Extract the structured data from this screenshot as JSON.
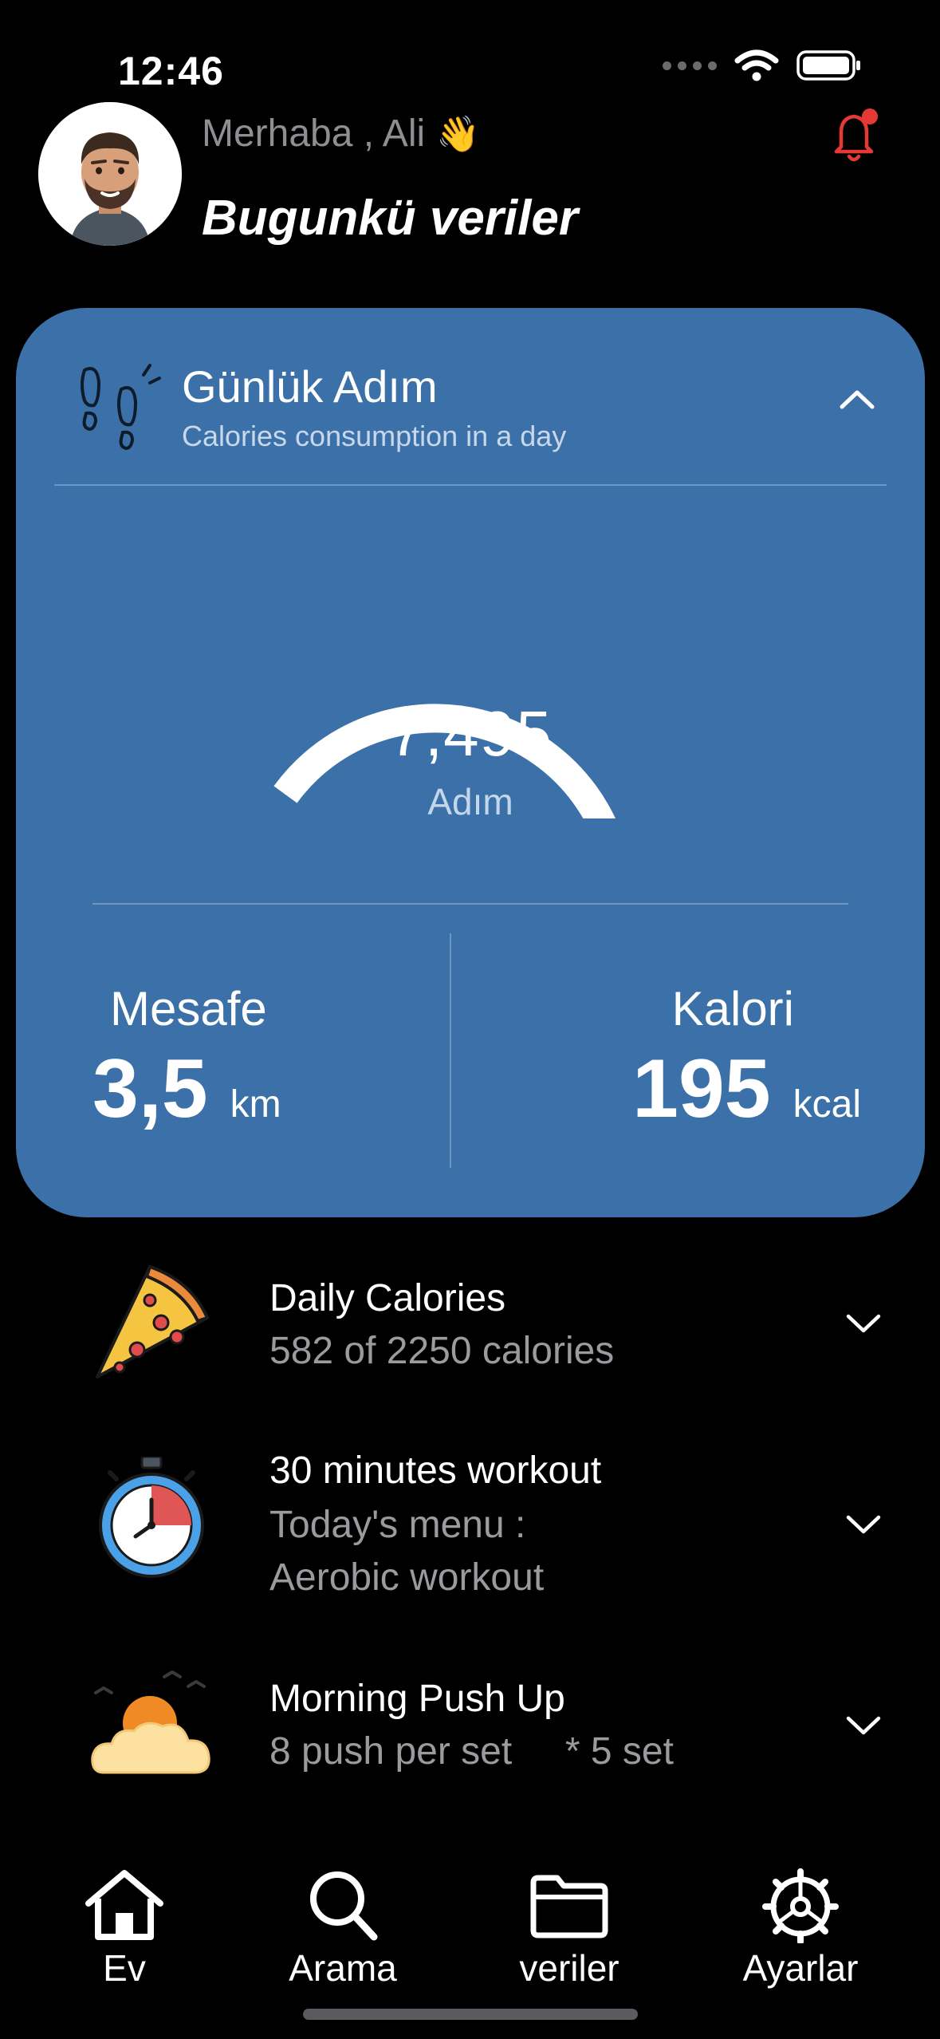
{
  "status_bar": {
    "time": "12:46"
  },
  "header": {
    "greeting": "Merhaba , Ali",
    "wave_emoji": "👋",
    "title": "Bugunkü veriler",
    "notification_icon": "bell-icon",
    "notification_color": "#e53935"
  },
  "steps_card": {
    "background": "#3b71a8",
    "title": "Günlük Adım",
    "subtitle": "Calories consumption in a day",
    "icon": "footprints-icon",
    "steps_value": "7,495",
    "steps_label": "Adım",
    "progress_fraction": 0.6,
    "distance": {
      "label": "Mesafe",
      "value": "3,5",
      "unit": "km"
    },
    "calories": {
      "label": "Kalori",
      "value": "195",
      "unit": "kcal"
    }
  },
  "activities": [
    {
      "icon": "pizza-icon",
      "title": "Daily Calories",
      "lines": [
        "582 of 2250 calories"
      ]
    },
    {
      "icon": "stopwatch-icon",
      "title": "30 minutes workout",
      "lines": [
        "Today's menu :",
        "Aerobic workout"
      ]
    },
    {
      "icon": "sun-cloud-icon",
      "title": "Morning Push Up",
      "lines": [
        "8 push per set     * 5 set"
      ]
    }
  ],
  "tab_bar": {
    "tabs": [
      {
        "icon": "home-icon",
        "label": "Ev"
      },
      {
        "icon": "search-icon",
        "label": "Arama"
      },
      {
        "icon": "folder-icon",
        "label": "veriler"
      },
      {
        "icon": "gear-icon",
        "label": "Ayarlar"
      }
    ]
  }
}
